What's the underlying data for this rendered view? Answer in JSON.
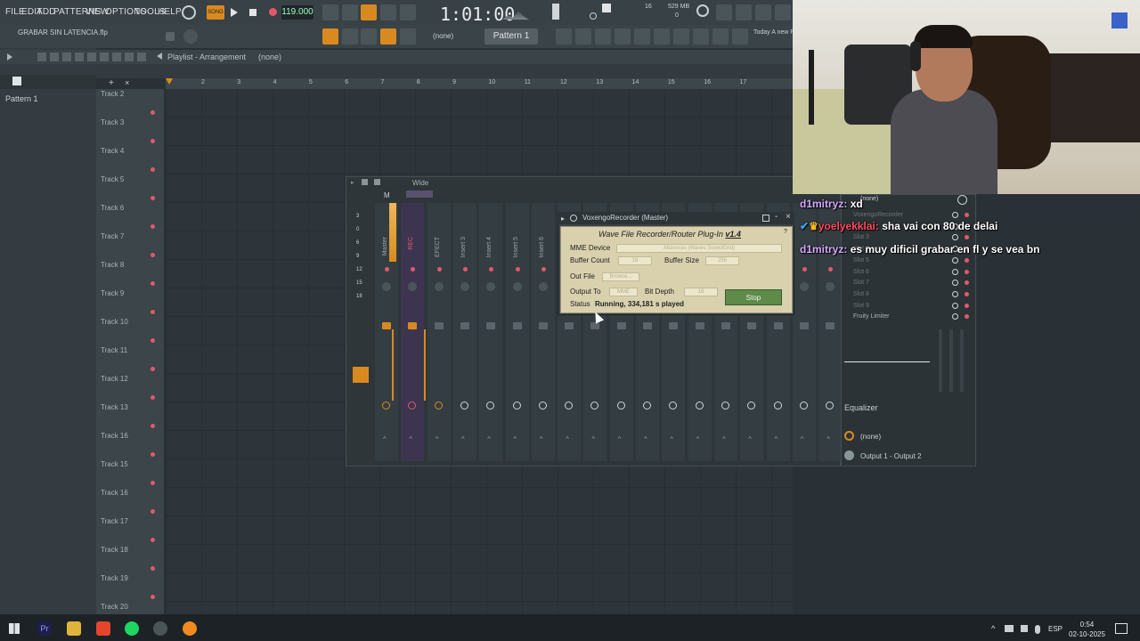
{
  "menu": {
    "file": "FILE",
    "edit": "EDIT",
    "add": "ADD",
    "patterns": "PATTERNS",
    "view": "VIEW",
    "options": "OPTIONS",
    "tools": "TOOLS",
    "help": "HELP"
  },
  "transport": {
    "song_badge": "SONG",
    "tempo": "119.000",
    "time": "1:01:00",
    "memory": "529 MB",
    "cpu_note": "16",
    "zero": "0"
  },
  "project": {
    "filename": "GRABAR SIN LATENCIA.flp",
    "pattern_selector": "Pattern 1",
    "channel_dropdown": "(none)",
    "news": "Today  A new\nFL Studio is a"
  },
  "browser": {
    "pattern_item": "Pattern 1"
  },
  "playlist": {
    "title": "Playlist - Arrangement",
    "title_suffix": "(none)",
    "ruler": [
      "2",
      "3",
      "4",
      "5",
      "6",
      "7",
      "8",
      "9",
      "10",
      "11",
      "12",
      "13",
      "14",
      "15",
      "16",
      "17"
    ],
    "tracks": [
      "Track 2",
      "Track 3",
      "Track 4",
      "Track 5",
      "Track 6",
      "Track 7",
      "Track 8",
      "Track 9",
      "Track 10",
      "Track 11",
      "Track 12",
      "Track 13",
      "Track 16",
      "Track 15",
      "Track 16",
      "Track 17",
      "Track 18",
      "Track 19",
      "Track 20"
    ]
  },
  "mixer": {
    "view_label": "Wide",
    "master_label": "M",
    "strip_labels": [
      "Master",
      "REC",
      "EFECT",
      "Insert 3",
      "Insert 4",
      "Insert 5",
      "Insert 6"
    ]
  },
  "voxengo": {
    "window_title": "VoxengoRecorder (Master)",
    "heading": "Wave File Recorder/Router Plug-In",
    "version": "v1.4",
    "mme_device_label": "MME Device",
    "mme_device_value": "Altavoces (Waves SoundGrid)",
    "buffer_count_label": "Buffer Count",
    "buffer_count_value": "16",
    "buffer_size_label": "Buffer Size",
    "buffer_size_value": "256",
    "out_file_label": "Out File",
    "browse_label": "Browse...",
    "output_to_label": "Output To",
    "output_to_value": "MME",
    "bit_depth_label": "Bit Depth",
    "bit_depth_value": "16",
    "status_label": "Status",
    "status_value": "Running, 334,181 s played",
    "stop_label": "Stop"
  },
  "fx": {
    "slot_selected": "(none)",
    "slots": [
      "VoxengoRecorder",
      "Slot 2",
      "Slot 3",
      "Slot 4",
      "Slot 5",
      "Slot 6",
      "Slot 7",
      "Slot 8",
      "Slot 9"
    ],
    "limiter": "Fruity Limiter",
    "eq_label": "Equalizer",
    "input": "(none)",
    "output": "Output 1 - Output 2"
  },
  "chat": [
    {
      "user": "d1mitryz:",
      "text": "xd"
    },
    {
      "user": "yoelyekklai:",
      "text": "sha vai con 80 de delai"
    },
    {
      "user": "d1mitryz:",
      "text": "es muy dificil grabar en fl y se vea bn"
    }
  ],
  "tray": {
    "lang": "ESP",
    "time": "0:54",
    "date": "02-10-2025"
  },
  "colors": {
    "accent_orange": "#d98a1f",
    "record_red": "#e05a6a",
    "plugin_bg": "#d9d0ae",
    "stop_green": "#5e8a4a"
  }
}
